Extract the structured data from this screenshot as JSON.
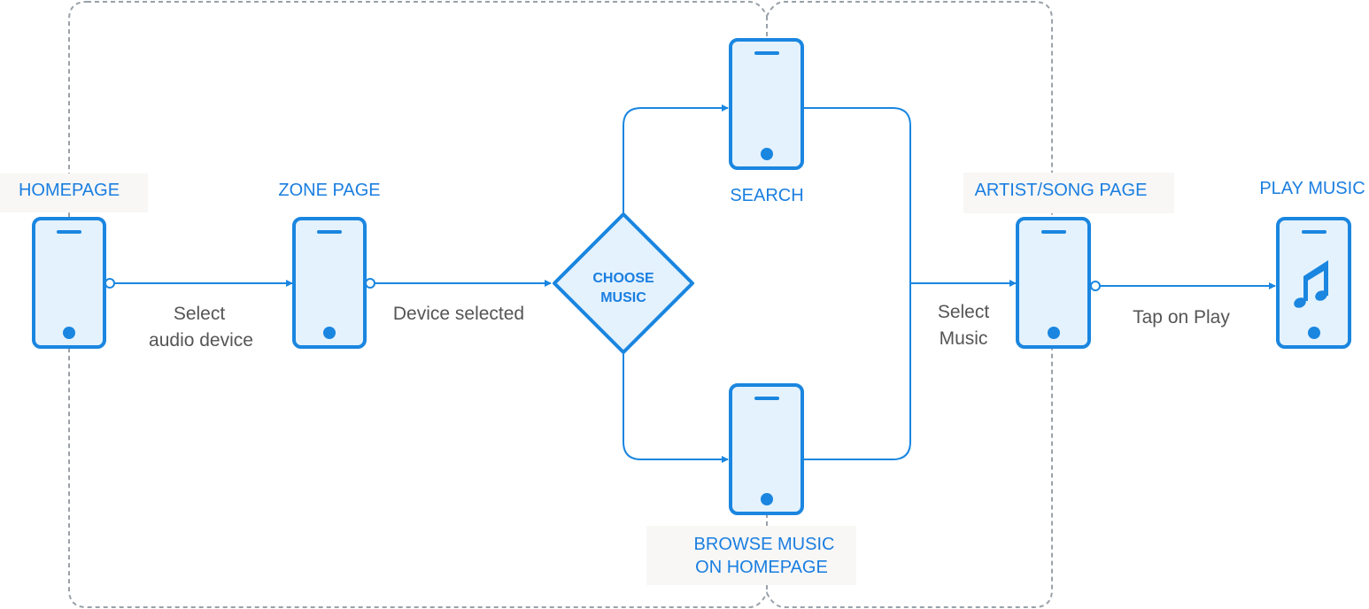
{
  "nodes": {
    "homepage": "HOMEPAGE",
    "zone_page": "ZONE PAGE",
    "choose_music_line1": "CHOOSE",
    "choose_music_line2": "MUSIC",
    "search": "SEARCH",
    "browse_line1": "BROWSE MUSIC",
    "browse_line2": "ON HOMEPAGE",
    "artist_song_page": "ARTIST/SONG PAGE",
    "play_music": "PLAY MUSIC"
  },
  "edges": {
    "select_audio_line1": "Select",
    "select_audio_line2": "audio device",
    "device_selected": "Device selected",
    "select_music_line1": "Select",
    "select_music_line2": "Music",
    "tap_on_play": "Tap on Play"
  },
  "colors": {
    "accent": "#1a86e0",
    "phone_fill": "#e4f2fd",
    "group_border": "#9aa1a8",
    "edge_text": "#555555"
  },
  "icons": {
    "phone": "smartphone-icon",
    "music": "music-note-icon"
  }
}
